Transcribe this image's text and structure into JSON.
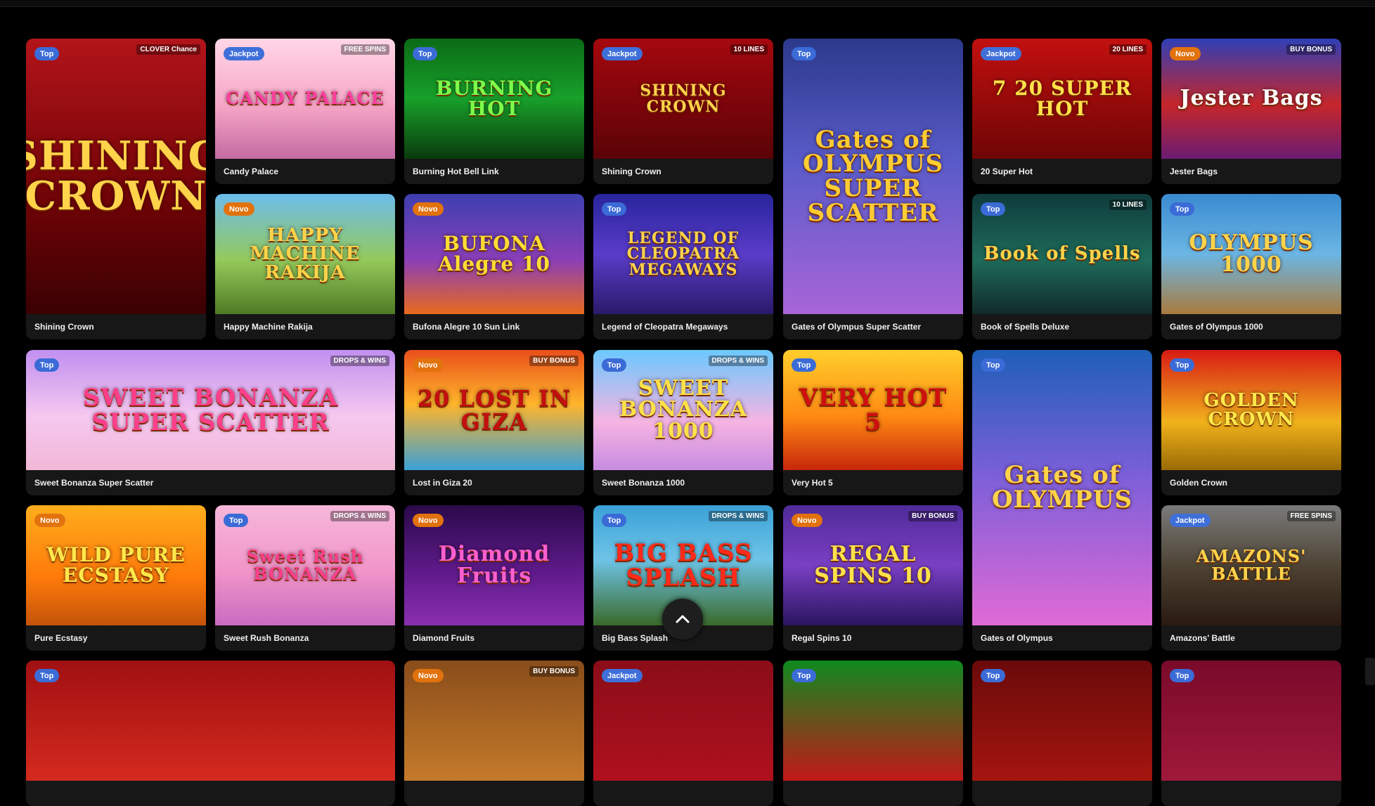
{
  "games": [
    {
      "name": "Shining Crown",
      "badge": "Top",
      "badge_kind": "top",
      "art": "SHINING CROWN",
      "corner": "CLOVER Chance",
      "bg": "linear-gradient(180deg,#b3141a 0%,#6e0306 60%,#3a0103 100%)",
      "art_color": "#ffd34a",
      "art_size": 56
    },
    {
      "name": "Candy Palace",
      "badge": "Jackpot",
      "badge_kind": "jackpot",
      "art": "CANDY PALACE",
      "corner": "FREE SPINS",
      "bg": "linear-gradient(180deg,#ffd6e6 0%,#f6a7c7 55%,#c46aa3 100%)",
      "art_color": "#ff3fa0",
      "art_size": 24
    },
    {
      "name": "Burning Hot Bell Link",
      "badge": "Top",
      "badge_kind": "top",
      "art": "BURNING HOT",
      "corner": "",
      "bg": "linear-gradient(180deg,#0b6b16 0%,#18a02a 50%,#0a3a0c 100%)",
      "art_color": "#7dff4a",
      "art_size": 28
    },
    {
      "name": "Shining Crown",
      "badge": "Jackpot",
      "badge_kind": "jackpot",
      "art": "SHINING CROWN",
      "corner": "10 LINES",
      "bg": "linear-gradient(180deg,#a5080e 0%,#5a0307 100%)",
      "art_color": "#ffd34a",
      "art_size": 22
    },
    {
      "name": "Gates of Olympus Super Scatter",
      "badge": "Top",
      "badge_kind": "top",
      "art": "Gates of OLYMPUS SUPER SCATTER",
      "corner": "",
      "bg": "linear-gradient(180deg,#2b3a8c 0%,#5a5bc9 45%,#a865d8 100%)",
      "art_color": "#ffcc33",
      "art_size": 34
    },
    {
      "name": "20 Super Hot",
      "badge": "Jackpot",
      "badge_kind": "jackpot",
      "art": "7 20 SUPER HOT",
      "corner": "20 LINES",
      "bg": "linear-gradient(180deg,#c2100f 0%,#6e0505 100%)",
      "art_color": "#ffe14a",
      "art_size": 28
    },
    {
      "name": "Jester Bags",
      "badge": "Novo",
      "badge_kind": "novo",
      "art": "Jester Bags",
      "corner": "BUY BONUS",
      "bg": "linear-gradient(180deg,#2f3fb7 0%,#c6262a 55%,#6a1c73 100%)",
      "art_color": "#ffffff",
      "art_size": 30
    },
    {
      "name": "Happy Machine Rakija",
      "badge": "Novo",
      "badge_kind": "novo",
      "art": "HAPPY MACHINE RAKIJA",
      "corner": "",
      "bg": "linear-gradient(180deg,#6cbcec 0%,#95c95b 55%,#4e7a24 100%)",
      "art_color": "#ffd34a",
      "art_size": 26
    },
    {
      "name": "Bufona Alegre 10 Sun Link",
      "badge": "Novo",
      "badge_kind": "novo",
      "art": "BUFONA Alegre 10",
      "corner": "",
      "bg": "linear-gradient(180deg,#3d3fb0 0%,#8b3fb7 55%,#e86a1d 100%)",
      "art_color": "#ffdd33",
      "art_size": 28
    },
    {
      "name": "Legend of Cleopatra Megaways",
      "badge": "Top",
      "badge_kind": "top",
      "art": "LEGEND OF CLEOPATRA MEGAWAYS",
      "corner": "",
      "bg": "linear-gradient(180deg,#27249b 0%,#5a3cc9 50%,#2a1a6a 100%)",
      "art_color": "#ffd34a",
      "art_size": 22
    },
    {
      "name": "Book of Spells Deluxe",
      "badge": "Top",
      "badge_kind": "top",
      "art": "Book of Spells",
      "corner": "10 LINES",
      "bg": "linear-gradient(180deg,#0f3b3c 0%,#1e6b5a 55%,#112a2a 100%)",
      "art_color": "#ffd34a",
      "art_size": 26
    },
    {
      "name": "Gates of Olympus 1000",
      "badge": "Top",
      "badge_kind": "top",
      "art": "OLYMPUS 1000",
      "corner": "",
      "bg": "linear-gradient(180deg,#3a8ad0 0%,#6bb6e4 50%,#a97b3d 100%)",
      "art_color": "#ffd34a",
      "art_size": 30
    },
    {
      "name": "Sweet Bonanza Super Scatter",
      "badge": "Top",
      "badge_kind": "top",
      "art": "SWEET BONANZA SUPER SCATTER",
      "corner": "DROPS & WINS",
      "bg": "linear-gradient(180deg,#c18ff0 0%,#f5c8f0 55%,#f2b8d6 100%)",
      "art_color": "#ff3f8a",
      "art_size": 34
    },
    {
      "name": "Lost in Giza 20",
      "badge": "Novo",
      "badge_kind": "novo",
      "art": "20 LOST IN GIZA",
      "corner": "BUY BONUS",
      "bg": "linear-gradient(180deg,#e94e1b 0%,#ffb52b 45%,#3aa0d6 100%)",
      "art_color": "#c40f0f",
      "art_size": 32
    },
    {
      "name": "Sweet Bonanza 1000",
      "badge": "Top",
      "badge_kind": "top",
      "art": "SWEET BONANZA 1000",
      "corner": "DROPS & WINS",
      "bg": "linear-gradient(180deg,#6bc8ff 0%,#f6b4e2 60%,#c78be0 100%)",
      "art_color": "#ffe14a",
      "art_size": 30
    },
    {
      "name": "Very Hot 5",
      "badge": "Top",
      "badge_kind": "top",
      "art": "VERY HOT 5",
      "corner": "",
      "bg": "linear-gradient(180deg,#ffce2b 0%,#ff8a12 55%,#c7260c 100%)",
      "art_color": "#d10f0f",
      "art_size": 34
    },
    {
      "name": "Gates of Olympus",
      "badge": "Top",
      "badge_kind": "top",
      "art": "Gates of OLYMPUS",
      "corner": "",
      "bg": "linear-gradient(180deg,#1e5fb8 0%,#7b5fd8 45%,#e06ad6 100%)",
      "art_color": "#ffd34a",
      "art_size": 34
    },
    {
      "name": "Golden Crown",
      "badge": "Top",
      "badge_kind": "top",
      "art": "GOLDEN CROWN",
      "corner": "",
      "bg": "linear-gradient(180deg,#d81a14 0%,#f1b21c 60%,#9a6a06 100%)",
      "art_color": "#ffe84a",
      "art_size": 26
    },
    {
      "name": "Pure Ecstasy",
      "badge": "Novo",
      "badge_kind": "novo",
      "art": "WILD PURE ECSTASY",
      "corner": "",
      "bg": "linear-gradient(180deg,#ffad1c 0%,#ff7a0a 60%,#c4540a 100%)",
      "art_color": "#ffe84a",
      "art_size": 28
    },
    {
      "name": "Sweet Rush Bonanza",
      "badge": "Top",
      "badge_kind": "top",
      "art": "Sweet Rush BONANZA",
      "corner": "DROPS & WINS",
      "bg": "linear-gradient(180deg,#f6b7da 0%,#f195c9 55%,#c96bc0 100%)",
      "art_color": "#ff3f8a",
      "art_size": 24
    },
    {
      "name": "Diamond Fruits",
      "badge": "Novo",
      "badge_kind": "novo",
      "art": "Diamond Fruits",
      "corner": "",
      "bg": "linear-gradient(180deg,#2a0a4a 0%,#5e1a8a 55%,#8a2fb0 100%)",
      "art_color": "#ff5fd0",
      "art_size": 30
    },
    {
      "name": "Big Bass Splash",
      "badge": "Top",
      "badge_kind": "top",
      "art": "BIG BASS SPLASH",
      "corner": "DROPS & WINS",
      "bg": "linear-gradient(180deg,#3aa0d6 0%,#6ec4e8 45%,#3a6a2a 100%)",
      "art_color": "#ff2a1a",
      "art_size": 34
    },
    {
      "name": "Regal Spins 10",
      "badge": "Novo",
      "badge_kind": "novo",
      "art": "REGAL SPINS 10",
      "corner": "BUY BONUS",
      "bg": "linear-gradient(180deg,#4f2b98 0%,#7a3fc4 50%,#2a1560 100%)",
      "art_color": "#ffe14a",
      "art_size": 30
    },
    {
      "name": "Amazons' Battle",
      "badge": "Jackpot",
      "badge_kind": "jackpot",
      "art": "AMAZONS' BATTLE",
      "corner": "FREE SPINS",
      "bg": "linear-gradient(180deg,#7a7a7a 0%,#4a3f2f 55%,#2a1a12 100%)",
      "art_color": "#ffd34a",
      "art_size": 24
    },
    {
      "name": "",
      "badge": "Top",
      "badge_kind": "top",
      "art": "",
      "corner": "",
      "bg": "linear-gradient(180deg,#a01012 0%,#d42a1e 100%)",
      "art_color": "#ffd34a",
      "art_size": 20
    },
    {
      "name": "",
      "badge": "Novo",
      "badge_kind": "novo",
      "art": "",
      "corner": "BUY BONUS",
      "bg": "linear-gradient(180deg,#8a4d1a 0%,#c47a2a 100%)",
      "art_color": "#ffd34a",
      "art_size": 20
    },
    {
      "name": "",
      "badge": "Jackpot",
      "badge_kind": "jackpot",
      "art": "",
      "corner": "",
      "bg": "linear-gradient(180deg,#8a0d18 0%,#b0101e 100%)",
      "art_color": "#ffd34a",
      "art_size": 20
    },
    {
      "name": "",
      "badge": "Top",
      "badge_kind": "top",
      "art": "",
      "corner": "",
      "bg": "linear-gradient(180deg,#0f8a1f 0%,#c21818 100%)",
      "art_color": "#ffd34a",
      "art_size": 20
    },
    {
      "name": "",
      "badge": "Top",
      "badge_kind": "top",
      "art": "",
      "corner": "",
      "bg": "linear-gradient(180deg,#6a0a0a 0%,#a4150f 100%)",
      "art_color": "#ffd34a",
      "art_size": 20
    },
    {
      "name": "",
      "badge": "Top",
      "badge_kind": "top",
      "art": "",
      "corner": "",
      "bg": "linear-gradient(180deg,#7a0a2a 0%,#a0183a 100%)",
      "art_color": "#ffd34a",
      "art_size": 20
    }
  ],
  "scroll_top_icon": "chevron-up-icon"
}
